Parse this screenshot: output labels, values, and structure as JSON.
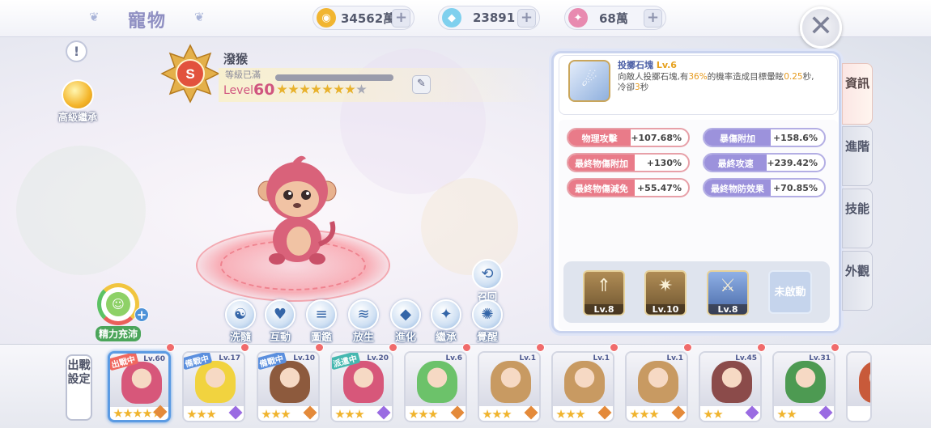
{
  "header": {
    "title": "寵物",
    "currencies": [
      {
        "name": "gold-coin",
        "value": "34562萬",
        "color": "#f1b531"
      },
      {
        "name": "diamond",
        "value": "23891",
        "color": "#7fd0ee"
      },
      {
        "name": "crystal",
        "value": "68萬",
        "color": "#e88ab0"
      }
    ]
  },
  "left": {
    "info_icon": "!",
    "inherit_label": "高級繼承",
    "energy_label": "精力充沛",
    "energy_plus": "+"
  },
  "pet": {
    "rank": "S",
    "name": "潑猴",
    "level_status": "等級已滿",
    "level_prefix": "Level",
    "level": "60",
    "stars": {
      "filled": 7,
      "total": 8
    },
    "level_progress": 1.0
  },
  "actions": [
    {
      "label": "洗髓",
      "icon": "wash-icon",
      "glyph": "☯"
    },
    {
      "label": "互動",
      "icon": "heart-icon",
      "glyph": "♥"
    },
    {
      "label": "圖鑑",
      "icon": "book-icon",
      "glyph": "≡"
    },
    {
      "label": "放生",
      "icon": "fish-icon",
      "glyph": "≋"
    },
    {
      "label": "進化",
      "icon": "crystal-icon",
      "glyph": "◆"
    },
    {
      "label": "繼承",
      "icon": "candy-icon",
      "glyph": "✦"
    },
    {
      "label": "覺醒",
      "icon": "awaken-icon",
      "glyph": "✺"
    }
  ],
  "recall": {
    "label": "召回",
    "glyph": "⟲"
  },
  "skill": {
    "name": "投擲石塊",
    "level": "Lv.6",
    "desc_a": "向敵人投擲石塊,有",
    "desc_pct": "36%",
    "desc_b": "的機率造成目標暈眩",
    "desc_sec": "0.25",
    "desc_c": "秒,冷卻",
    "desc_cd": "3",
    "desc_d": "秒"
  },
  "stats": [
    {
      "label": "物理攻擊",
      "value": "+107.68%",
      "style": "red"
    },
    {
      "label": "暴傷附加",
      "value": "+158.6%",
      "style": "pur"
    },
    {
      "label": "最終物傷附加",
      "value": "+130%",
      "style": "red"
    },
    {
      "label": "最終攻速",
      "value": "+239.42%",
      "style": "pur"
    },
    {
      "label": "最終物傷減免",
      "value": "+55.47%",
      "style": "red"
    },
    {
      "label": "最終物防效果",
      "value": "+70.85%",
      "style": "pur"
    }
  ],
  "skills_row": [
    {
      "level": "Lv.8",
      "icon": "arrow-up-skill-icon",
      "glyph": "⇑",
      "style": "brown"
    },
    {
      "level": "Lv.10",
      "icon": "burst-skill-icon",
      "glyph": "✷",
      "style": "brown"
    },
    {
      "level": "Lv.8",
      "icon": "sword-skill-icon",
      "glyph": "⚔",
      "style": "blue"
    }
  ],
  "inactive_label": "未啟動",
  "tabs": [
    "資訊",
    "進階",
    "技能",
    "外觀"
  ],
  "deploy_label": "出戰設定",
  "roster": [
    {
      "level": "Lv.60",
      "badge": "出戰中",
      "badge_color": "#f0685f",
      "stars": 5,
      "color": "#d7577a",
      "gem": "#e48a3a",
      "selected": true
    },
    {
      "level": "Lv.17",
      "badge": "備戰中",
      "badge_color": "#5b8fde",
      "stars": 3,
      "color": "#f1d33f",
      "gem": "#9a6be2"
    },
    {
      "level": "Lv.10",
      "badge": "備戰中",
      "badge_color": "#5b8fde",
      "stars": 3,
      "color": "#8d5a3d",
      "gem": "#e48a3a"
    },
    {
      "level": "Lv.20",
      "badge": "派遣中",
      "badge_color": "#46b8b0",
      "stars": 3,
      "color": "#d7577a",
      "gem": "#9a6be2"
    },
    {
      "level": "Lv.6",
      "badge": "",
      "badge_color": "",
      "stars": 3,
      "color": "#6cc26a",
      "gem": "#e48a3a"
    },
    {
      "level": "Lv.1",
      "badge": "",
      "badge_color": "",
      "stars": 3,
      "color": "#c89a62",
      "gem": "#e48a3a"
    },
    {
      "level": "Lv.1",
      "badge": "",
      "badge_color": "",
      "stars": 3,
      "color": "#c89a62",
      "gem": "#e48a3a"
    },
    {
      "level": "Lv.1",
      "badge": "",
      "badge_color": "",
      "stars": 3,
      "color": "#c89a62",
      "gem": "#e48a3a"
    },
    {
      "level": "Lv.45",
      "badge": "",
      "badge_color": "",
      "stars": 2,
      "color": "#8b4b4a",
      "gem": "#9a6be2"
    },
    {
      "level": "Lv.31",
      "badge": "",
      "badge_color": "",
      "stars": 2,
      "color": "#4d9a52",
      "gem": "#9a6be2"
    },
    {
      "level": "",
      "badge": "",
      "badge_color": "",
      "stars": 0,
      "color": "#c85a3a",
      "gem": ""
    }
  ]
}
